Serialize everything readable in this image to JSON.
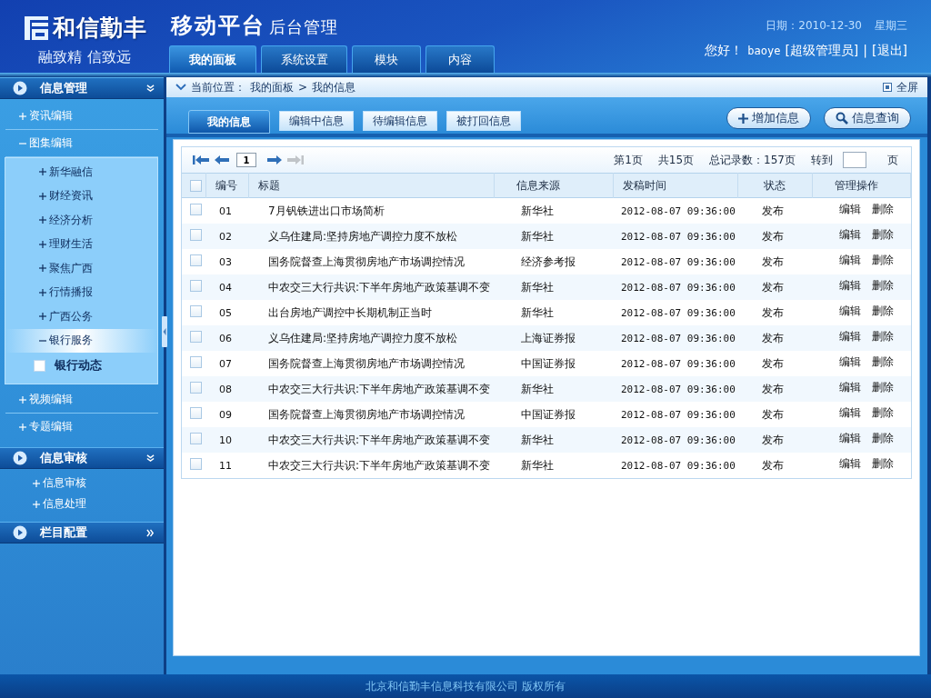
{
  "header": {
    "brand": "和信勤丰",
    "slogan": "融致精 信致远",
    "title": "移动平台",
    "subtitle": "后台管理",
    "date": "日期：2010-12-30",
    "weekday": "星期三",
    "greeting": "您好！",
    "user": "baoye",
    "role": "[超级管理员]",
    "separator": "|",
    "logout": "[退出]",
    "nav": [
      {
        "label": "我的面板",
        "selected": true
      },
      {
        "label": "系统设置",
        "selected": false
      },
      {
        "label": "模块",
        "selected": false
      },
      {
        "label": "内容",
        "selected": false
      }
    ]
  },
  "sidebar": {
    "sections": [
      {
        "title": "信息管理",
        "expanded": true,
        "items": [
          {
            "label": "资讯编辑",
            "expanded": false,
            "selected": false
          },
          {
            "label": "图集编辑",
            "expanded": true,
            "selected": false,
            "children": [
              {
                "label": "新华融信",
                "expanded": false,
                "selected": false
              },
              {
                "label": "财经资讯",
                "expanded": false,
                "selected": false
              },
              {
                "label": "经济分析",
                "expanded": false,
                "selected": false
              },
              {
                "label": "理财生活",
                "expanded": false,
                "selected": false
              },
              {
                "label": "聚焦广西",
                "expanded": false,
                "selected": false
              },
              {
                "label": "行情播报",
                "expanded": false,
                "selected": false
              },
              {
                "label": "广西公务",
                "expanded": false,
                "selected": false
              },
              {
                "label": "银行服务",
                "expanded": true,
                "selected": true,
                "children": [
                  {
                    "label": "银行动态",
                    "checked": false
                  }
                ]
              }
            ]
          },
          {
            "label": "视频编辑",
            "expanded": false,
            "selected": false
          },
          {
            "label": "专题编辑",
            "expanded": false,
            "selected": false
          }
        ]
      },
      {
        "title": "信息审核",
        "expanded": true,
        "items": [
          {
            "label": "信息审核",
            "expanded": false,
            "selected": false
          },
          {
            "label": "信息处理",
            "expanded": false,
            "selected": false
          }
        ]
      },
      {
        "title": "栏目配置",
        "expanded": false
      }
    ]
  },
  "breadcrumb": {
    "label": "当前位置：",
    "items": [
      "我的面板",
      "我的信息"
    ],
    "separator": ">",
    "fullscreen": "全屏"
  },
  "tabs": [
    {
      "label": "我的信息",
      "selected": true
    },
    {
      "label": "编辑中信息",
      "selected": false
    },
    {
      "label": "待编辑信息",
      "selected": false
    },
    {
      "label": "被打回信息",
      "selected": false
    }
  ],
  "actions": [
    {
      "kind": "add",
      "label": "增加信息"
    },
    {
      "kind": "search",
      "label": "信息查询"
    }
  ],
  "pager": {
    "buttons": [
      {
        "kind": "first",
        "disabled": false
      },
      {
        "kind": "prev",
        "disabled": false
      },
      {
        "kind": "next",
        "disabled": false
      },
      {
        "kind": "last",
        "disabled": true
      }
    ],
    "page_value": "1",
    "current": "第1页",
    "total_pages": "共15页",
    "total_records": "总记录数：157页",
    "goto": "转到",
    "goto_suffix": "页"
  },
  "table": {
    "all_checked": false,
    "columns": [
      "编号",
      "标题",
      "信息来源",
      "发稿时间",
      "状态",
      "管理操作"
    ],
    "rows": [
      {
        "id": "01",
        "title": "7月钒铁进出口市场简析",
        "source": "新华社",
        "time": "2012-08-07 09:36:00",
        "status": "发布",
        "checked": false,
        "actions": [
          "编辑",
          "删除"
        ]
      },
      {
        "id": "02",
        "title": "义乌住建局:坚持房地产调控力度不放松",
        "source": "新华社",
        "time": "2012-08-07 09:36:00",
        "status": "发布",
        "checked": false,
        "actions": [
          "编辑",
          "删除"
        ]
      },
      {
        "id": "03",
        "title": "国务院督查上海贯彻房地产市场调控情况",
        "source": "经济参考报",
        "time": "2012-08-07 09:36:00",
        "status": "发布",
        "checked": false,
        "actions": [
          "编辑",
          "删除"
        ]
      },
      {
        "id": "04",
        "title": "中农交三大行共识:下半年房地产政策基调不变",
        "source": "新华社",
        "time": "2012-08-07 09:36:00",
        "status": "发布",
        "checked": false,
        "actions": [
          "编辑",
          "删除"
        ]
      },
      {
        "id": "05",
        "title": "出台房地产调控中长期机制正当时",
        "source": "新华社",
        "time": "2012-08-07 09:36:00",
        "status": "发布",
        "checked": false,
        "actions": [
          "编辑",
          "删除"
        ]
      },
      {
        "id": "06",
        "title": "义乌住建局:坚持房地产调控力度不放松",
        "source": "上海证券报",
        "time": "2012-08-07 09:36:00",
        "status": "发布",
        "checked": false,
        "actions": [
          "编辑",
          "删除"
        ]
      },
      {
        "id": "07",
        "title": "国务院督查上海贯彻房地产市场调控情况",
        "source": "中国证券报",
        "time": "2012-08-07 09:36:00",
        "status": "发布",
        "checked": false,
        "actions": [
          "编辑",
          "删除"
        ]
      },
      {
        "id": "08",
        "title": "中农交三大行共识:下半年房地产政策基调不变",
        "source": "新华社",
        "time": "2012-08-07 09:36:00",
        "status": "发布",
        "checked": false,
        "actions": [
          "编辑",
          "删除"
        ]
      },
      {
        "id": "09",
        "title": "国务院督查上海贯彻房地产市场调控情况",
        "source": "中国证券报",
        "time": "2012-08-07 09:36:00",
        "status": "发布",
        "checked": false,
        "actions": [
          "编辑",
          "删除"
        ]
      },
      {
        "id": "10",
        "title": "中农交三大行共识:下半年房地产政策基调不变",
        "source": "新华社",
        "time": "2012-08-07 09:36:00",
        "status": "发布",
        "checked": false,
        "actions": [
          "编辑",
          "删除"
        ]
      },
      {
        "id": "11",
        "title": "中农交三大行共识:下半年房地产政策基调不变",
        "source": "新华社",
        "time": "2012-08-07 09:36:00",
        "status": "发布",
        "checked": false,
        "actions": [
          "编辑",
          "删除"
        ]
      }
    ]
  },
  "footer": "北京和信勤丰信息科技有限公司  版权所有"
}
